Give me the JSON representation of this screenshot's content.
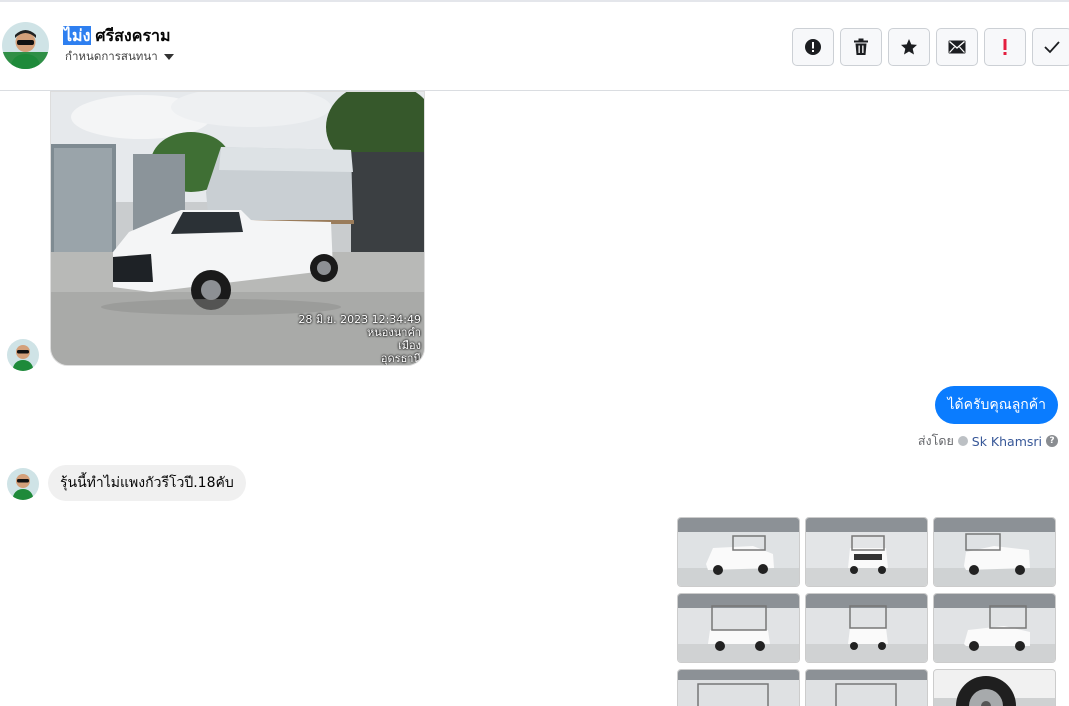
{
  "header": {
    "name_highlight": "ไม่ง",
    "name_rest": "ศรีสงคราม",
    "assign_label": "กำหนดการสนทนา"
  },
  "toolbar": [
    {
      "name": "spam-button",
      "icon": "alert-circle-icon"
    },
    {
      "name": "delete-button",
      "icon": "trash-icon"
    },
    {
      "name": "star-button",
      "icon": "star-icon"
    },
    {
      "name": "mark-unread-button",
      "icon": "envelope-icon"
    },
    {
      "name": "follow-up-button",
      "icon": "exclamation-icon"
    },
    {
      "name": "mark-done-button",
      "icon": "checkmark-icon"
    }
  ],
  "messages": {
    "photo_stamp": {
      "date": "28 มิ.ย. 2023 12:34:49",
      "line2": "หนองนาคำ",
      "line3": "เมือง",
      "line4": "อุดรธานี"
    },
    "outgoing_text": "ได้ครับคุณลูกค้า",
    "sent_by_prefix": "ส่งโดย",
    "sent_by_name": "Sk Khamsri",
    "incoming_text": "รุ้นนี้ทำไม่แพงกัวรีโวปี.18คับ"
  },
  "colors": {
    "accent": "#0a7cff",
    "highlight": "#2e7ff0",
    "follow_up": "#e41e3f"
  }
}
